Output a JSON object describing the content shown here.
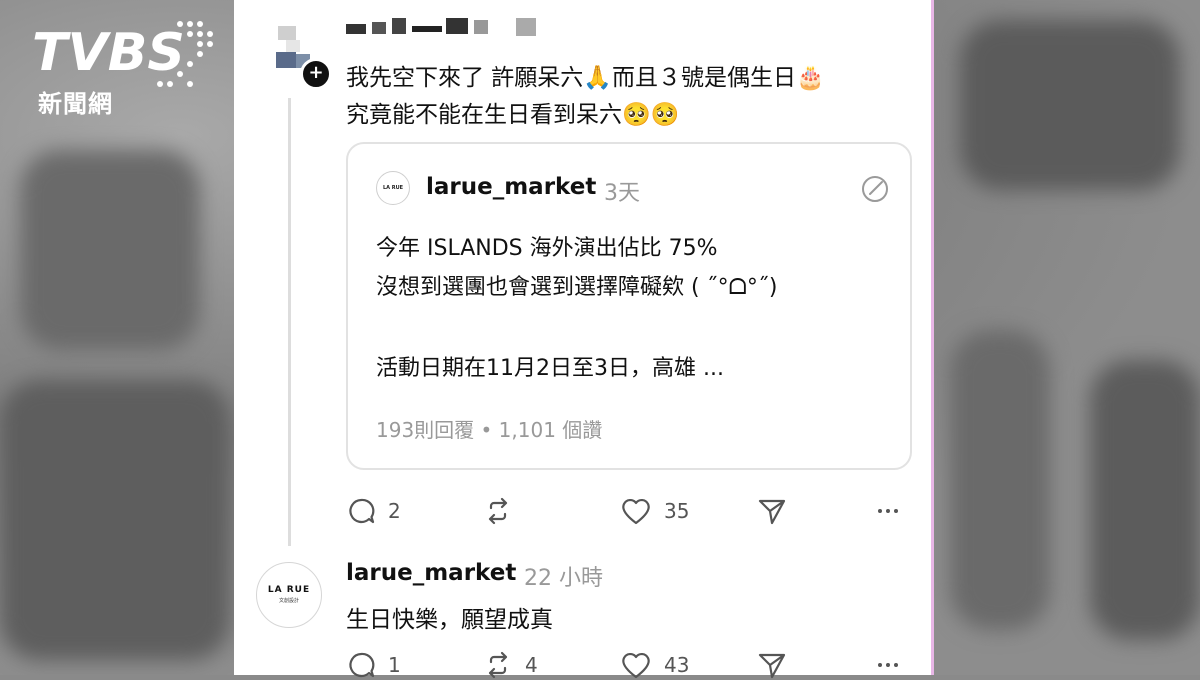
{
  "watermark": {
    "brand": "TVBS",
    "subtitle": "新聞網"
  },
  "post": {
    "line1": "我先空下來了 許願呆六🙏而且３號是偶生日🎂",
    "line2": "究竟能不能在生日看到呆六🥺🥺",
    "follow_icon": "+",
    "quote": {
      "logo_text": "LA RUE",
      "username": "larue_market",
      "time": "3天",
      "lines": [
        "今年 ISLANDS 海外演出佔比 75%",
        "沒想到選團也會選到選擇障礙欸 ( ˝°ᗝ°˝)",
        "活動日期在11月2日至3日，高雄 ..."
      ],
      "stats": "193則回覆 • 1,101 個讚"
    },
    "actions": {
      "comments": "2",
      "reposts": "",
      "likes": "35"
    }
  },
  "reply": {
    "logo_line1": "LA RUE",
    "logo_line2": "文創設計",
    "username": "larue_market",
    "time": "22 小時",
    "text": "生日快樂，願望成真",
    "actions": {
      "comments": "1",
      "reposts": "4",
      "likes": "43"
    }
  },
  "icons": {
    "comment": "comment-icon",
    "repost": "repost-icon",
    "like": "heart-icon",
    "share": "send-icon",
    "more": "more-icon",
    "edit": "edit-icon"
  }
}
